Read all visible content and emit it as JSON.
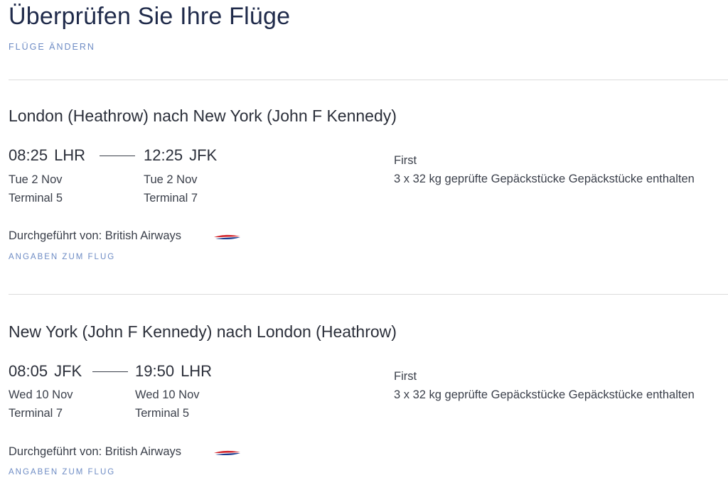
{
  "header": {
    "title": "Überprüfen Sie Ihre Flüge",
    "change_link": "FLÜGE ÄNDERN"
  },
  "colors": {
    "link": "#6d8bc4",
    "text": "#2b2f3a",
    "divider": "#dcdcdc",
    "ba_red": "#d2232a",
    "ba_blue": "#1a3c8f"
  },
  "legs": [
    {
      "route": "London (Heathrow) nach New York (John F Kennedy)",
      "departure": {
        "time": "08:25",
        "code": "LHR",
        "date": "Tue 2 Nov",
        "terminal": "Terminal 5"
      },
      "arrival": {
        "time": "12:25",
        "code": "JFK",
        "date": "Tue 2 Nov",
        "terminal": "Terminal 7"
      },
      "cabin": "First",
      "baggage": "3 x 32 kg geprüfte Gepäckstücke Gepäckstücke enthalten",
      "operator": "Durchgeführt von: British Airways",
      "operator_logo": "british-airways-speedmarque-icon",
      "details_link": "ANGABEN ZUM FLUG"
    },
    {
      "route": "New York (John F Kennedy) nach London (Heathrow)",
      "departure": {
        "time": "08:05",
        "code": "JFK",
        "date": "Wed 10 Nov",
        "terminal": "Terminal 7"
      },
      "arrival": {
        "time": "19:50",
        "code": "LHR",
        "date": "Wed 10 Nov",
        "terminal": "Terminal 5"
      },
      "cabin": "First",
      "baggage": "3 x 32 kg geprüfte Gepäckstücke Gepäckstücke enthalten",
      "operator": "Durchgeführt von: British Airways",
      "operator_logo": "british-airways-speedmarque-icon",
      "details_link": "ANGABEN ZUM FLUG"
    }
  ]
}
